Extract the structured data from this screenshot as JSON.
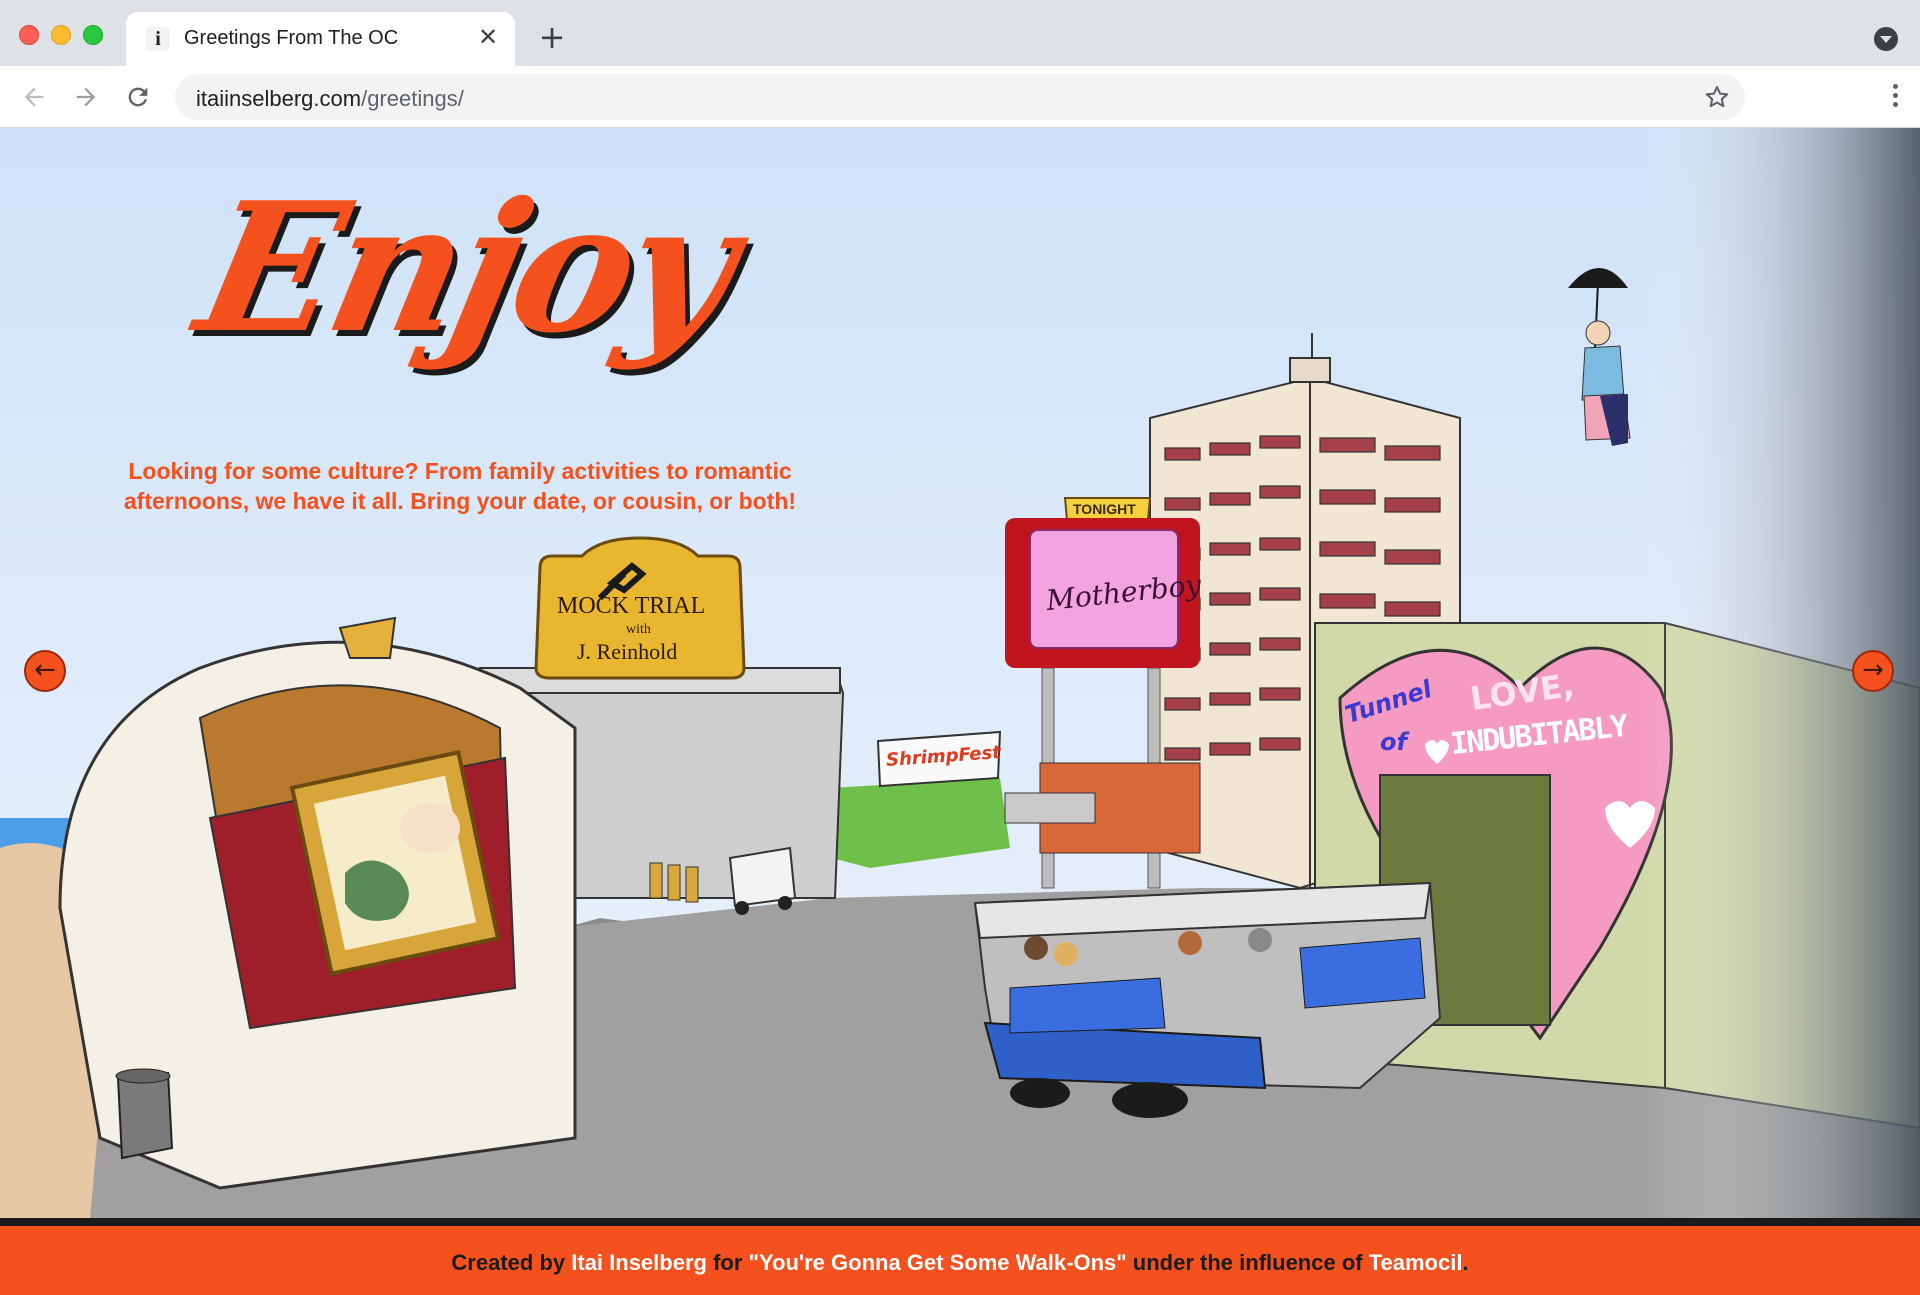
{
  "browser": {
    "tab_title": "Greetings From The OC",
    "favicon_glyph": "i",
    "close_glyph": "✕",
    "new_tab_glyph": "+",
    "url_host": "itaiinselberg.com",
    "url_path": "/greetings/"
  },
  "hero": {
    "title": "Enjoy",
    "tagline": "Looking for some culture? From family activities to romantic afternoons, we have it all. Bring your date, or cousin, or both!"
  },
  "carousel": {
    "prev_glyph": "←",
    "next_glyph": "→"
  },
  "scene_signs": {
    "mock_trial_line1": "MOCK TRIAL",
    "mock_trial_line2": "with",
    "mock_trial_line3": "J. Reinhold",
    "tonight": "TONIGHT",
    "motherboy": "Motherboy",
    "shrimpfest": "ShrimpFest",
    "tunnel_line1": "Tunnel",
    "tunnel_line2": "of",
    "love": "LOVE,",
    "indubitably": "INDUBITABLY"
  },
  "footer": {
    "created_by": "Created by ",
    "author": "Itai Inselberg",
    "for_text": " for ",
    "episode": "\"You're Gonna Get Some Walk-Ons\"",
    "influence_text": " under the influence of ",
    "teamocil": "Teamocil",
    "period": "."
  },
  "colors": {
    "accent": "#f4511e",
    "sky": "#d6e6f7",
    "ground": "#9b9b9b"
  }
}
